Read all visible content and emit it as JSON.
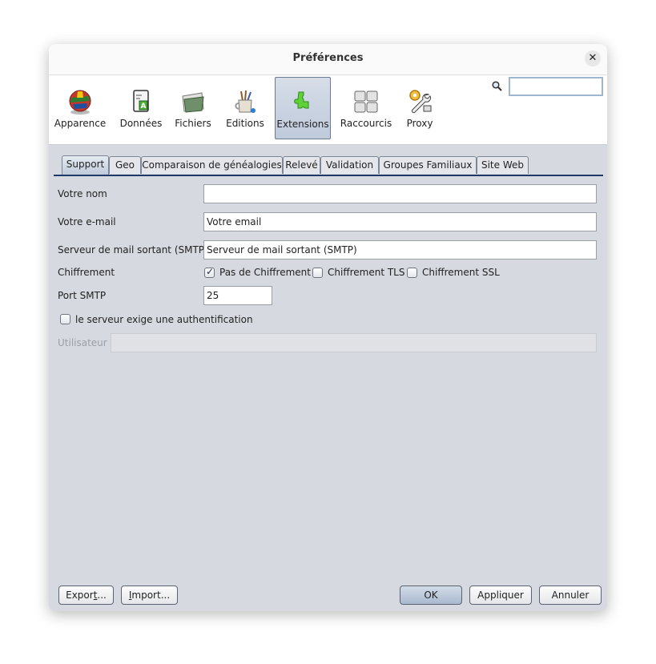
{
  "dialog": {
    "title": "Préférences",
    "close_icon": "close-icon"
  },
  "toolbar": {
    "items": [
      {
        "label": "Apparence",
        "icon": "globe-flags-icon"
      },
      {
        "label": "Données",
        "icon": "document-a-icon"
      },
      {
        "label": "Fichiers",
        "icon": "folder-icon"
      },
      {
        "label": "Editions",
        "icon": "paint-brushes-mug-icon"
      },
      {
        "label": "Extensions",
        "icon": "puzzle-piece-icon",
        "active": true
      },
      {
        "label": "Raccourcis",
        "icon": "keyboard-keys-icon"
      },
      {
        "label": "Proxy",
        "icon": "gear-wrench-icon"
      }
    ],
    "search": {
      "icon": "search-icon",
      "value": "",
      "placeholder": ""
    }
  },
  "tabs": [
    {
      "label": "Support",
      "active": true
    },
    {
      "label": "Geo"
    },
    {
      "label": "Comparaison de généalogies"
    },
    {
      "label": "Relevé"
    },
    {
      "label": "Validation"
    },
    {
      "label": "Groupes Familiaux"
    },
    {
      "label": "Site Web"
    }
  ],
  "form": {
    "name": {
      "label": "Votre nom",
      "value": ""
    },
    "email": {
      "label": "Votre e-mail",
      "value": "Votre email"
    },
    "smtp": {
      "label": "Serveur de mail sortant (SMTP)",
      "value": "Serveur de mail sortant (SMTP)"
    },
    "encryption": {
      "label": "Chiffrement",
      "options": [
        {
          "label": "Pas de Chiffrement",
          "checked": true
        },
        {
          "label": "Chiffrement TLS",
          "checked": false
        },
        {
          "label": "Chiffrement SSL",
          "checked": false
        }
      ]
    },
    "port": {
      "label": "Port SMTP",
      "value": "25"
    },
    "auth": {
      "label": "le serveur exige une authentification",
      "checked": false
    },
    "user": {
      "label": "Utilisateur",
      "value": "",
      "disabled": true
    }
  },
  "buttons": {
    "export": {
      "pre": "Expor",
      "mnemonic": "t",
      "post": "..."
    },
    "import": {
      "pre": "",
      "mnemonic": "I",
      "post": "mport..."
    },
    "ok": "OK",
    "apply": "Appliquer",
    "cancel": "Annuler"
  }
}
